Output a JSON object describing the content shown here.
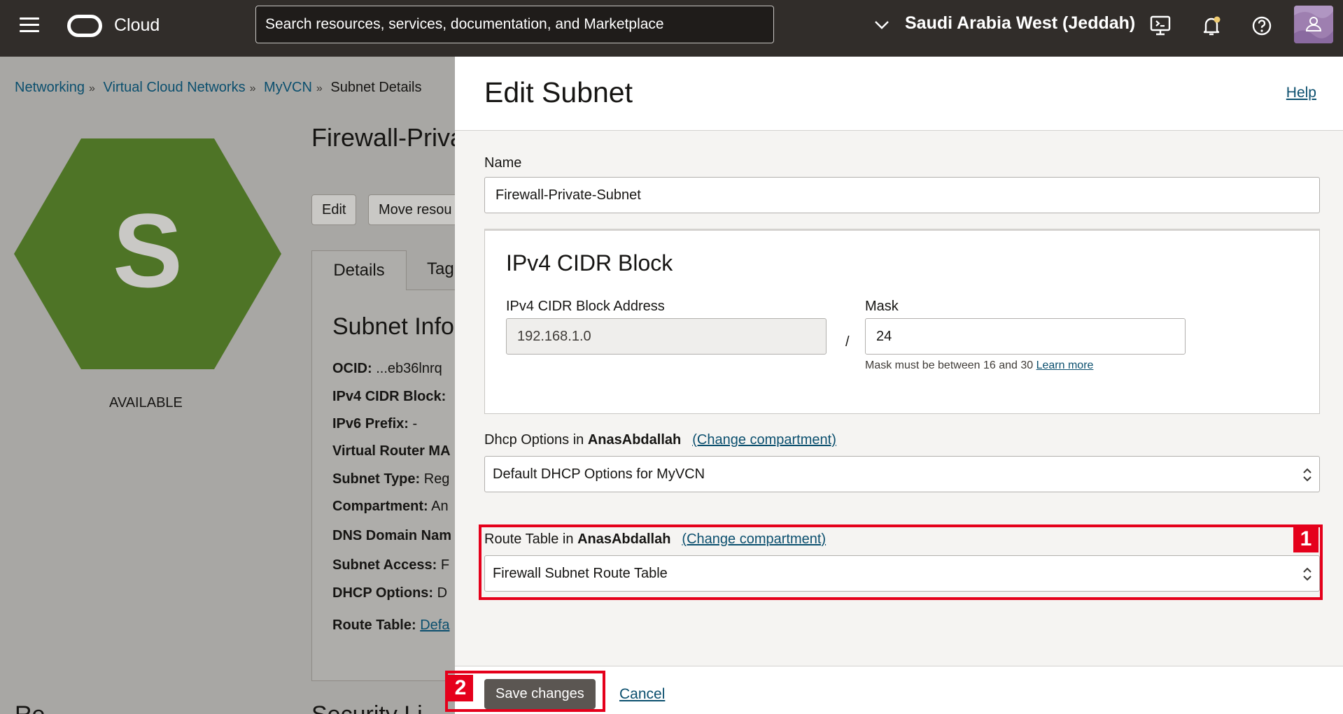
{
  "header": {
    "brand": "Cloud",
    "search_placeholder": "Search resources, services, documentation, and Marketplace",
    "region": "Saudi Arabia West (Jeddah)"
  },
  "breadcrumb": {
    "items": [
      "Networking",
      "Virtual Cloud Networks",
      "MyVCN"
    ],
    "current": "Subnet Details"
  },
  "resource": {
    "icon_letter": "S",
    "status": "AVAILABLE",
    "title": "Firewall-Priva",
    "hex_color": "#4e7426"
  },
  "actions": {
    "edit": "Edit",
    "move": "Move resou"
  },
  "tabs": {
    "details": "Details",
    "tags": "Tag"
  },
  "subnet_info": {
    "title": "Subnet Info",
    "rows": [
      {
        "label": "OCID:",
        "value": " ...eb36lnrq"
      },
      {
        "label": "IPv4 CIDR Block:",
        "value": ""
      },
      {
        "label": "IPv6 Prefix:",
        "value": " -"
      },
      {
        "label": "Virtual Router MA",
        "value": ""
      },
      {
        "label": "Subnet Type:",
        "value": " Reg"
      },
      {
        "label": "Compartment:",
        "value": " An"
      },
      {
        "label": "DNS Domain Nam",
        "value": ""
      },
      {
        "label": "Subnet Access:",
        "value": " F"
      },
      {
        "label": "DHCP Options:",
        "value": " D"
      }
    ],
    "route_label": "Route Table:",
    "route_link": "Defa",
    "security_heading": "Security Li",
    "resources_heading": "Re"
  },
  "drawer": {
    "title": "Edit Subnet",
    "help": "Help",
    "name_label": "Name",
    "name_value": "Firewall-Private-Subnet",
    "cidr": {
      "title": "IPv4 CIDR Block",
      "address_label": "IPv4 CIDR Block Address",
      "address_value": "192.168.1.0",
      "separator": "/",
      "mask_label": "Mask",
      "mask_value": "24",
      "hint": "Mask must be between 16 and 30",
      "learn_more": "Learn more"
    },
    "dhcp": {
      "label": "Dhcp Options in",
      "compartment": "AnasAbdallah",
      "change": "(Change compartment)",
      "value": "Default DHCP Options for MyVCN"
    },
    "route": {
      "label": "Route Table in",
      "compartment": "AnasAbdallah",
      "change": "(Change compartment)",
      "value": "Firewall Subnet Route Table"
    },
    "save": "Save changes",
    "cancel": "Cancel"
  },
  "annotations": {
    "step1": "1",
    "step2": "2",
    "color": "#e5001b"
  }
}
